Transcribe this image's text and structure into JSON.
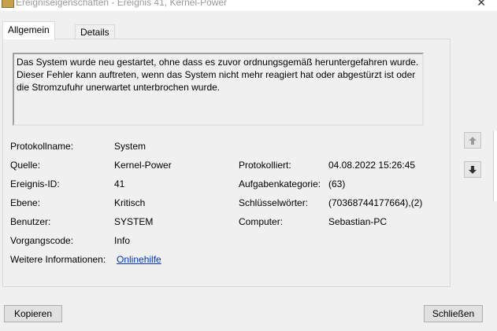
{
  "window": {
    "title": "Ereigniseigenschaften - Ereignis 41, Kernel-Power",
    "close_glyph": "✕"
  },
  "tabs": [
    {
      "label": "Allgemein",
      "active": true
    },
    {
      "label": "Details",
      "active": false
    }
  ],
  "description": "Das System wurde neu gestartet, ohne dass es zuvor ordnungsgemäß heruntergefahren wurde. Dieser Fehler kann auftreten, wenn das System nicht mehr reagiert hat oder abgestürzt ist oder die Stromzufuhr unerwartet unterbrochen wurde.",
  "fields": {
    "protokollname": {
      "label": "Protokollname:",
      "value": "System"
    },
    "quelle": {
      "label": "Quelle:",
      "value": "Kernel-Power"
    },
    "ereignis_id": {
      "label": "Ereignis-ID:",
      "value": "41"
    },
    "ebene": {
      "label": "Ebene:",
      "value": "Kritisch"
    },
    "benutzer": {
      "label": "Benutzer:",
      "value": "SYSTEM"
    },
    "vorgangscode": {
      "label": "Vorgangscode:",
      "value": "Info"
    },
    "weitere": {
      "label": "Weitere Informationen:",
      "value": "Onlinehilfe"
    },
    "protokolliert": {
      "label": "Protokolliert:",
      "value": "04.08.2022 15:26:45"
    },
    "aufgabenkategorie": {
      "label": "Aufgabenkategorie:",
      "value": "(63)"
    },
    "schluesselwoerter": {
      "label": "Schlüsselwörter:",
      "value": "(70368744177664),(2)"
    },
    "computer": {
      "label": "Computer:",
      "value": "Sebastian-PC"
    }
  },
  "buttons": {
    "copy": "Kopieren",
    "close": "Schließen"
  },
  "icons": {
    "nav_up": "arrow-up-icon",
    "nav_down": "arrow-down-icon"
  }
}
